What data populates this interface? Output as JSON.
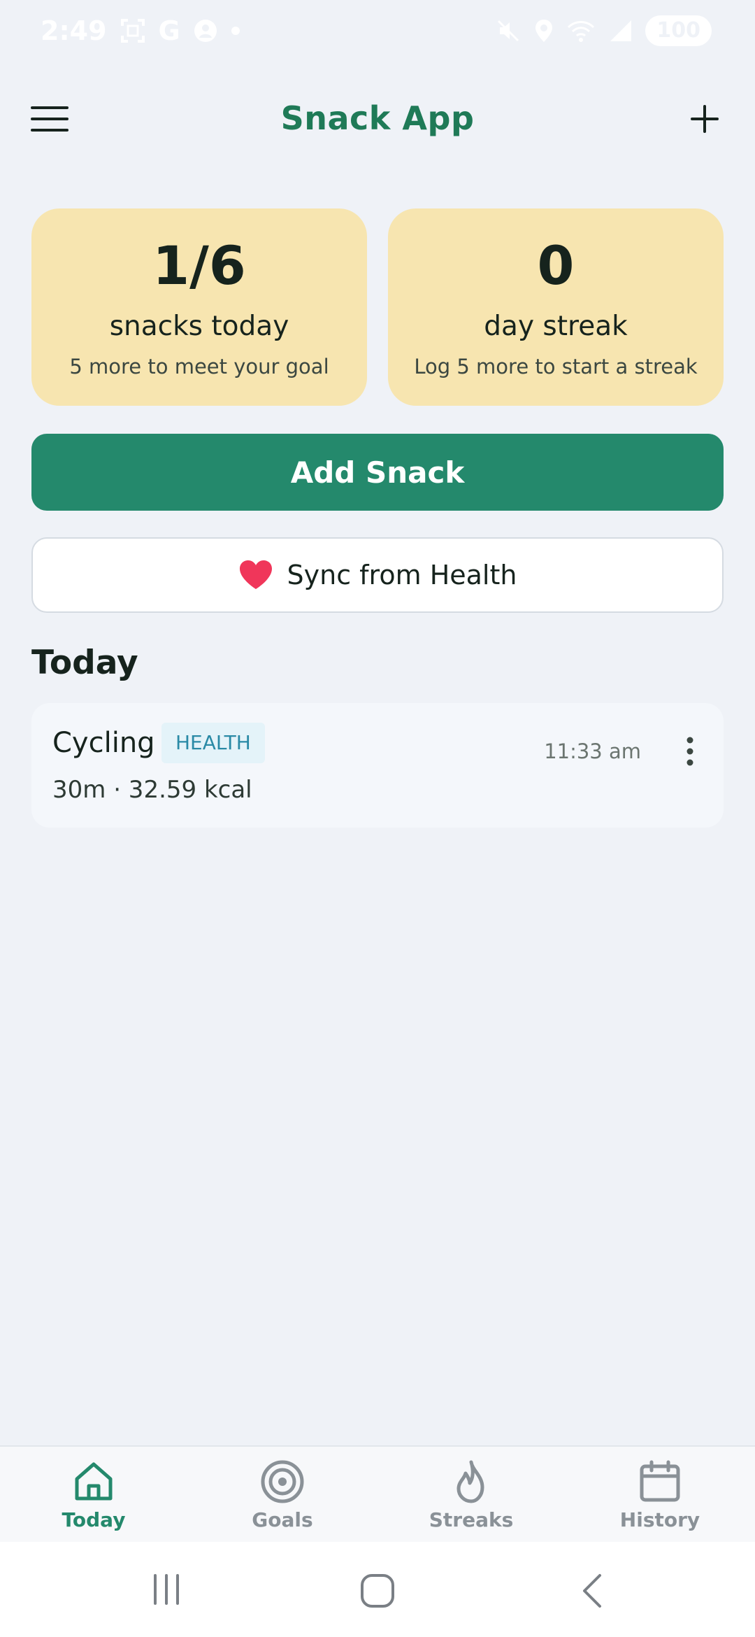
{
  "status_bar": {
    "time": "2:49",
    "carrier_glyph": "G",
    "battery": "100",
    "icons": [
      "screenshot-icon",
      "account-icon",
      "dot-icon",
      "mute-icon",
      "location-icon",
      "wifi-icon",
      "signal-icon"
    ]
  },
  "header": {
    "title": "Snack App",
    "menu_icon": "hamburger-menu-icon",
    "add_icon": "plus-icon"
  },
  "stats": [
    {
      "value": "1/6",
      "label": "snacks today",
      "sub": "5 more to meet your goal"
    },
    {
      "value": "0",
      "label": "day streak",
      "sub": "Log 5 more to start a streak"
    }
  ],
  "actions": {
    "add_snack_label": "Add Snack",
    "sync_label": "Sync from Health",
    "sync_icon": "heart-icon"
  },
  "today": {
    "title": "Today",
    "entries": [
      {
        "name": "Cycling",
        "tag": "HEALTH",
        "meta": "30m · 32.59 kcal",
        "time": "11:33 am"
      }
    ]
  },
  "bottom_nav": {
    "items": [
      {
        "label": "Today",
        "icon": "home-icon",
        "active": true
      },
      {
        "label": "Goals",
        "icon": "target-icon",
        "active": false
      },
      {
        "label": "Streaks",
        "icon": "flame-icon",
        "active": false
      },
      {
        "label": "History",
        "icon": "calendar-icon",
        "active": false
      }
    ]
  },
  "colors": {
    "accent": "#24896c",
    "title": "#1f7a57",
    "card": "#f7e5b0",
    "heart": "#f0365a",
    "inactive": "#8a9197"
  }
}
